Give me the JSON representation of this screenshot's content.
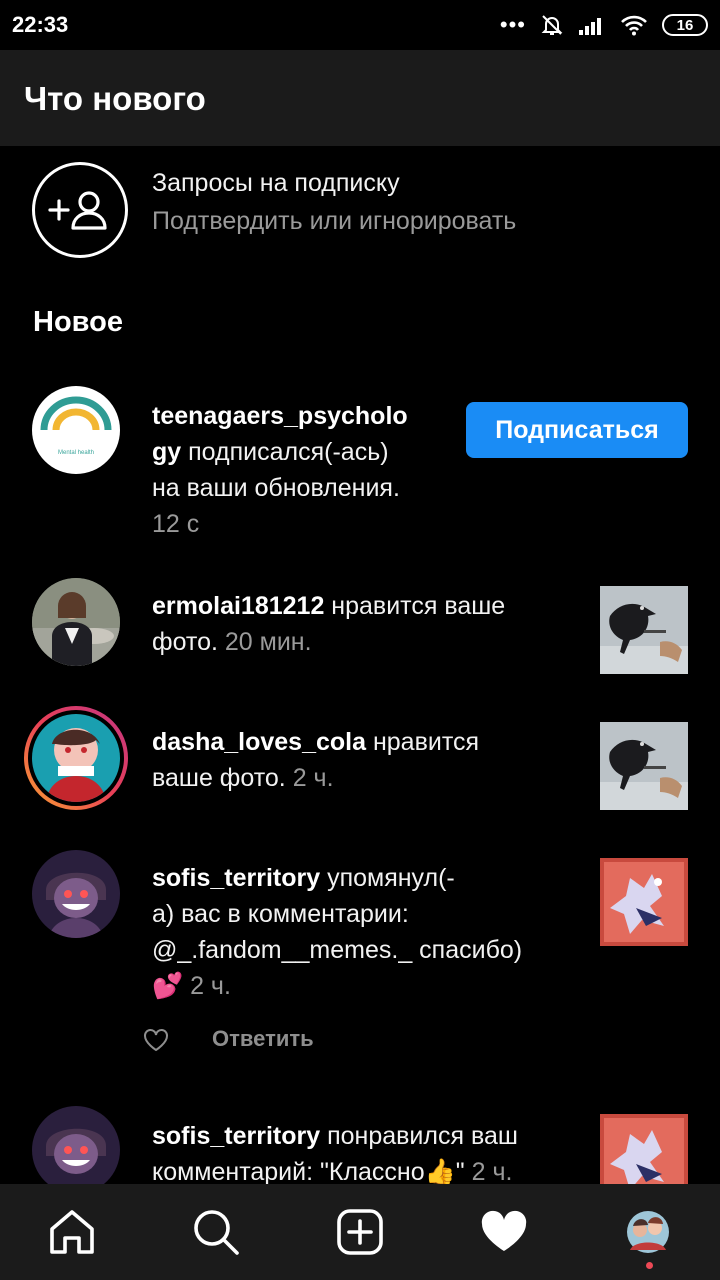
{
  "status_bar": {
    "time": "22:33",
    "dots": "•••",
    "battery": "16"
  },
  "header": {
    "title": "Что нового"
  },
  "requests": {
    "title": "Запросы на подписку",
    "subtitle": "Подтвердить или игнорировать"
  },
  "section_label": "Новое",
  "notifications": [
    {
      "username_part1": "teenagaers_psycholo",
      "username_part2": "gy",
      "action_part1": " подписался(-ась)",
      "action_part2": "на ваши обновления.",
      "time": "12 с",
      "button": "Подписаться",
      "avatar_caption": "Mental health"
    },
    {
      "username": "ermolai181212",
      "action_part1": " нравится ваше",
      "action_part2": "фото. ",
      "time": "20 мин."
    },
    {
      "username": "dasha_loves_cola",
      "action_part1": " нравится",
      "action_part2": "ваше фото. ",
      "time": "2 ч."
    },
    {
      "username": "sofis_territory",
      "action_part1": " упомянул(-",
      "action_part2": "а) вас в комментарии:",
      "action_part3": "@_.fandom__memes._ спасибо)",
      "emoji": "💕",
      "time": " 2 ч.",
      "reply": "Ответить"
    },
    {
      "username": "sofis_territory",
      "action_part1": " понравился ваш",
      "action_part2": "комментарий: \"Классно",
      "emoji": "👍",
      "action_part3": "\" ",
      "time": "2 ч."
    }
  ],
  "bottom_nav": [
    "home-icon",
    "search-icon",
    "new-post-icon",
    "activity-heart-icon",
    "profile-avatar"
  ]
}
